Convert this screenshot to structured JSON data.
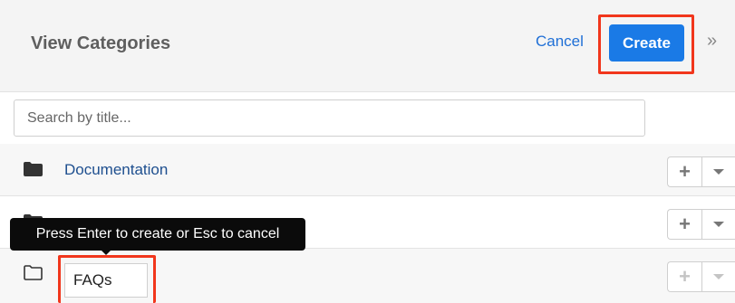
{
  "header": {
    "title": "View Categories",
    "cancel_label": "Cancel",
    "create_label": "Create",
    "collapse_glyph": "»"
  },
  "search": {
    "placeholder": "Search by title...",
    "value": ""
  },
  "rows": [
    {
      "label": "Documentation",
      "icon": "folder-solid-icon"
    },
    {
      "label": "",
      "icon": "folder-solid-icon"
    },
    {
      "label": "",
      "icon": "folder-outline-icon",
      "input_value": "FAQs"
    }
  ],
  "row_actions": {
    "plus_glyph": "+"
  },
  "tooltip": {
    "text": "Press Enter to create or Esc to cancel"
  },
  "colors": {
    "accent": "#1a7ae6",
    "highlight": "#f1361c",
    "link": "#1e4f8f"
  }
}
